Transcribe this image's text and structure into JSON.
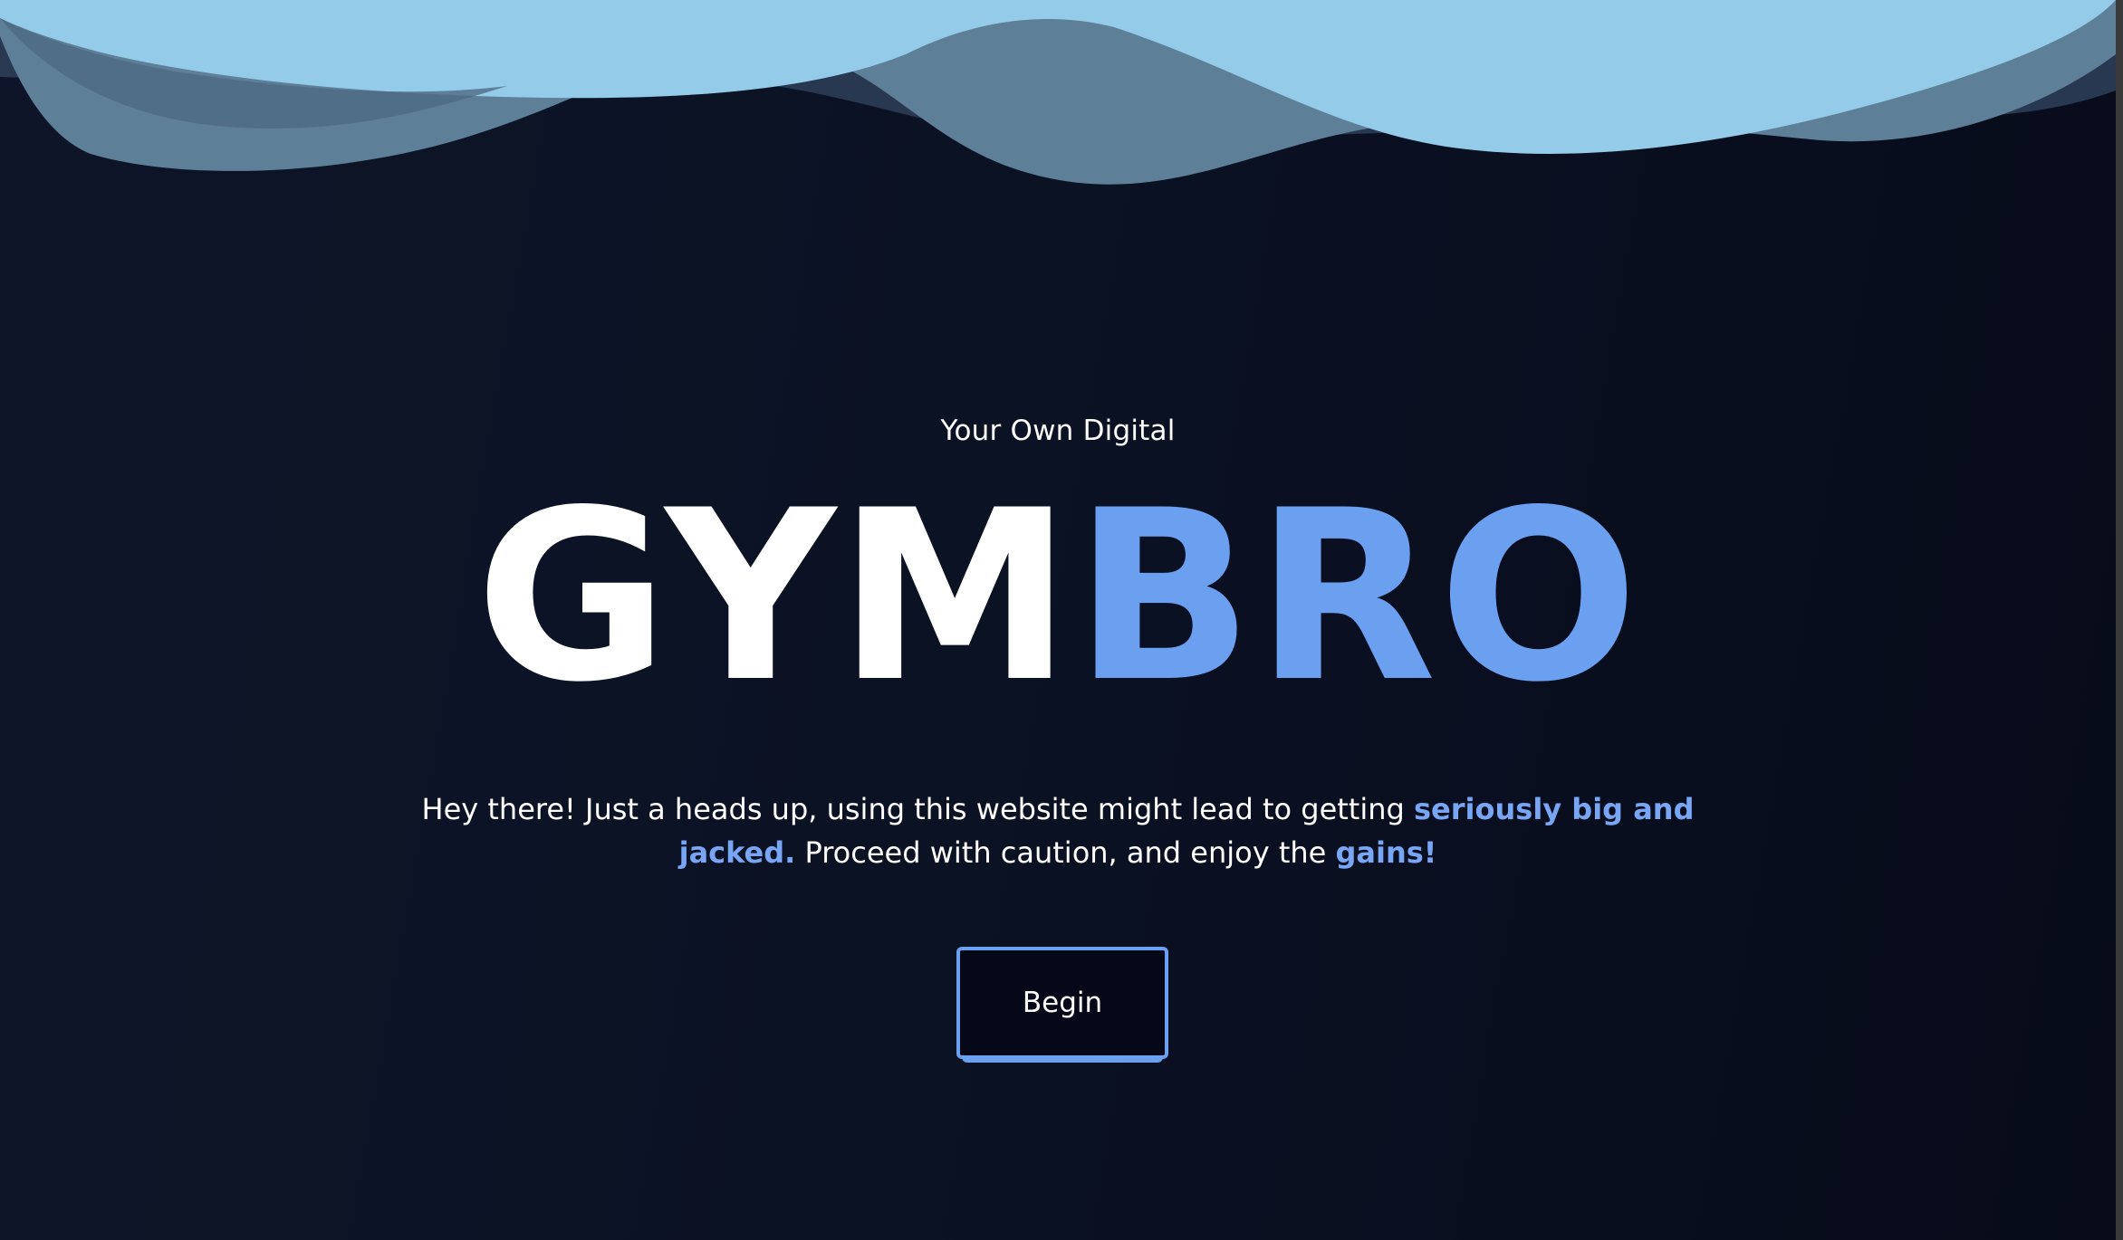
{
  "hero": {
    "eyebrow": "Your Own Digital",
    "title_part1": "GYM",
    "title_part2": "BRO",
    "description": {
      "part1": "Hey there! Just a heads up, using this website might lead to getting ",
      "highlight1": "seriously big and jacked.",
      "part2": " Proceed with caution, and enjoy the ",
      "highlight2": "gains!"
    },
    "begin_button": "Begin"
  },
  "colors": {
    "background": "#0b1122",
    "accent": "#6b9ff0",
    "wave_light": "#94cbe8",
    "wave_mid": "#5f8099",
    "text": "#ffffff"
  }
}
